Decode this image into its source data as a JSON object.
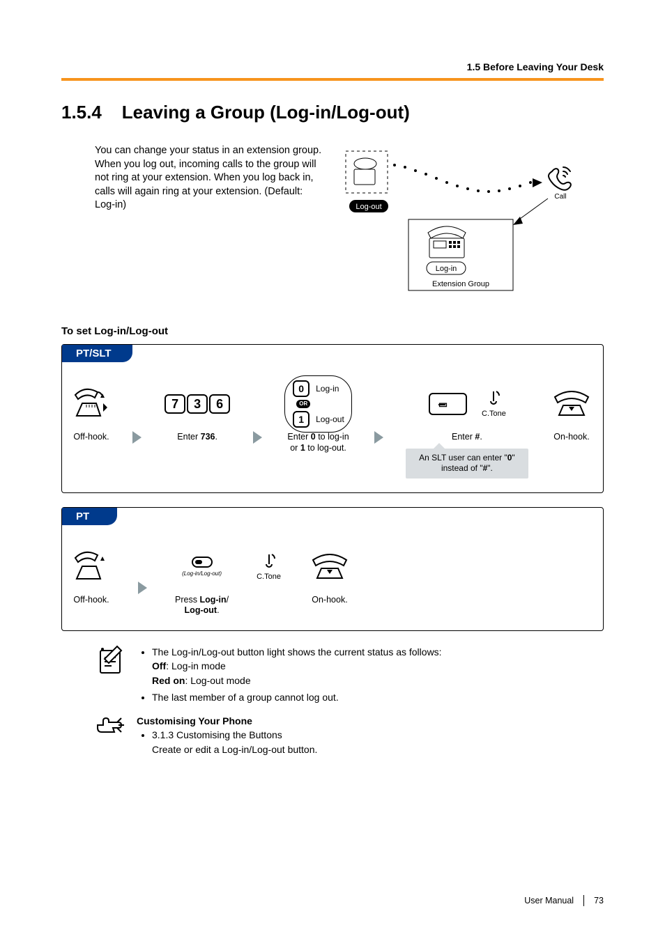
{
  "running_head": "1.5 Before Leaving Your Desk",
  "section_number": "1.5.4",
  "section_title": "Leaving a Group (Log-in/Log-out)",
  "intro": "You can change your status in an extension group. When you log out, incoming calls to the group will not ring at your extension. When you log back in, calls will again ring at your extension. (Default: Log-in)",
  "diagram": {
    "logout_label": "Log-out",
    "login_label": "Log-in",
    "call_label": "Call",
    "ext_group_label": "Extension Group"
  },
  "subheading": "To set Log-in/Log-out",
  "flow1": {
    "tab": "PT/SLT",
    "offhook": "Off-hook.",
    "keys": [
      "7",
      "3",
      "6"
    ],
    "enter736": "Enter 736.",
    "choice_login_key": "0",
    "choice_login_label": "Log-in",
    "or_label": "OR",
    "choice_logout_key": "1",
    "choice_logout_label": "Log-out",
    "choice_caption_pre": "Enter ",
    "choice_caption_b1": "0",
    "choice_caption_mid": " to log-in\nor ",
    "choice_caption_b2": "1",
    "choice_caption_post": " to log-out.",
    "hash_caption_pre": "Enter ",
    "hash_caption_b": "#",
    "hash_caption_post": ".",
    "ctone": "C.Tone",
    "onhook": "On-hook.",
    "slt_note_pre": "An SLT user can enter \"",
    "slt_note_b1": "0",
    "slt_note_mid": "\" instead of \"",
    "slt_note_b2": "#",
    "slt_note_post": "\"."
  },
  "flow2": {
    "tab": "PT",
    "offhook": "Off-hook.",
    "btn_sub": "(Log-in/Log-out)",
    "press_pre": "Press ",
    "press_b1": "Log-in",
    "press_slash": "/\n",
    "press_b2": "Log-out",
    "press_post": ".",
    "ctone": "C.Tone",
    "onhook": "On-hook."
  },
  "notes1": {
    "bullet1": "The Log-in/Log-out button light shows the current status as follows:",
    "off_b": "Off",
    "off_t": ": Log-in mode",
    "red_b": "Red on",
    "red_t": ": Log-out mode",
    "bullet2": "The last member of a group cannot log out."
  },
  "notes2": {
    "title": "Customising Your Phone",
    "bullet_link": "3.1.3 Customising the Buttons",
    "bullet_desc": "Create or edit a Log-in/Log-out button."
  },
  "footer": {
    "manual": "User Manual",
    "page": "73"
  }
}
